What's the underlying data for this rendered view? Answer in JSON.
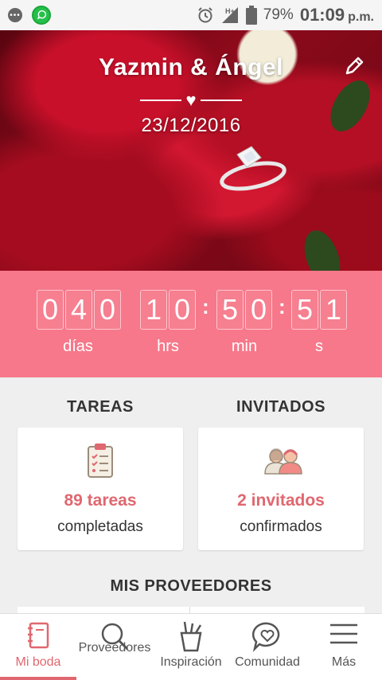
{
  "status_bar": {
    "battery": "79%",
    "time": "01:09",
    "ampm": "p.m.",
    "network": "H+"
  },
  "hero": {
    "couple": "Yazmin & Ángel",
    "date": "23/12/2016"
  },
  "countdown": {
    "days": [
      "0",
      "4",
      "0"
    ],
    "hours": [
      "1",
      "0"
    ],
    "minutes": [
      "5",
      "0"
    ],
    "seconds": [
      "5",
      "1"
    ],
    "labels": {
      "days": "días",
      "hours": "hrs",
      "minutes": "min",
      "seconds": "s"
    }
  },
  "tasks": {
    "title": "TAREAS",
    "value": "89 tareas",
    "sub": "completadas"
  },
  "guests": {
    "title": "INVITADOS",
    "value": "2 invitados",
    "sub": "confirmados"
  },
  "providers_title": "MIS PROVEEDORES",
  "nav": {
    "items": [
      {
        "label": "Mi boda",
        "icon": "notebook-icon",
        "active": true
      },
      {
        "label": "Proveedores",
        "icon": "search-icon",
        "active": false
      },
      {
        "label": "Inspiración",
        "icon": "pencil-cup-icon",
        "active": false
      },
      {
        "label": "Comunidad",
        "icon": "heart-chat-icon",
        "active": false
      },
      {
        "label": "Más",
        "icon": "menu-icon",
        "active": false
      }
    ]
  },
  "colors": {
    "accent": "#e0676f",
    "countdown_bg": "#f6788a"
  }
}
